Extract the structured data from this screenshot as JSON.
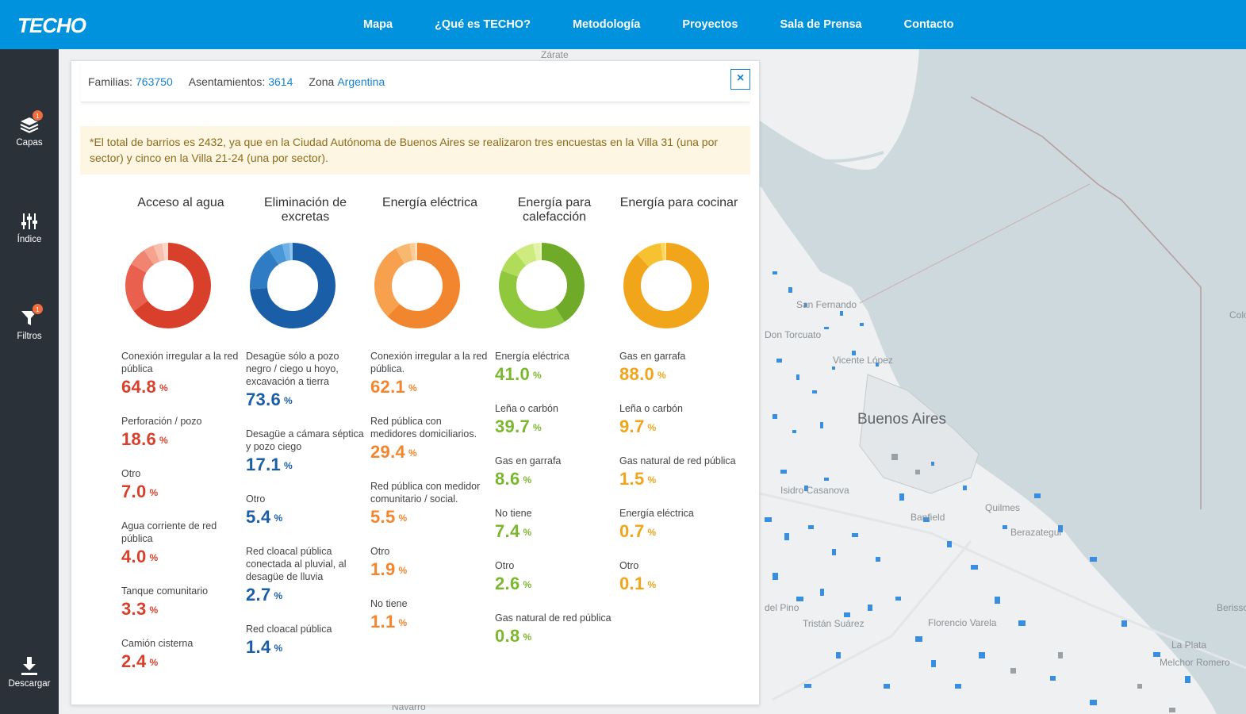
{
  "header": {
    "logo": "TECHO",
    "nav": [
      "Mapa",
      "¿Qué es TECHO?",
      "Metodología",
      "Proyectos",
      "Sala de Prensa",
      "Contacto"
    ]
  },
  "sidebar": {
    "items": [
      {
        "label": "Capas",
        "icon": "layers-icon",
        "badge": "1"
      },
      {
        "label": "Índice",
        "icon": "sliders-icon",
        "badge": ""
      },
      {
        "label": "Filtros",
        "icon": "filter-icon",
        "badge": "1"
      },
      {
        "label": "Descargar",
        "icon": "download-icon",
        "badge": ""
      }
    ]
  },
  "map": {
    "labels": [
      "Zárate",
      "San Fernando",
      "Don Torcuato",
      "Vicente López",
      "Buenos Aires",
      "Isidro Casanova",
      "Banfield",
      "Quilmes",
      "Berazategui",
      "del Pino",
      "Tristán Suárez",
      "Florencio Varela",
      "La Plata",
      "Melchor Romero",
      "Berisso",
      "Colonia del Sacramento",
      "Navarro"
    ]
  },
  "panel": {
    "stats": {
      "familias_label": "Familias:",
      "familias_value": "763750",
      "asentamientos_label": "Asentamientos:",
      "asentamientos_value": "3614",
      "zona_label": "Zona",
      "zona_value": "Argentina"
    },
    "close_label": "×",
    "note": "*El total de barrios es 2432, ya que en la Ciudad Autónoma de Buenos Aires se realizaron tres encuestas en la Villa 31 (una por sector) y cinco en la Villa 21-24 (una por sector).",
    "columns": [
      {
        "title": "Acceso al agua",
        "color": "#d8402c",
        "ring_colors": [
          "#d8402c",
          "#e9604f",
          "#f08470",
          "#f5a38f",
          "#f8bfae",
          "#fbd6cb"
        ],
        "items": [
          {
            "label": "Conexión irregular a la red pública",
            "value": "64.8"
          },
          {
            "label": "Perforación / pozo",
            "value": "18.6"
          },
          {
            "label": "Otro",
            "value": "7.0"
          },
          {
            "label": "Agua corriente de red pública",
            "value": "4.0"
          },
          {
            "label": "Tanque comunitario",
            "value": "3.3"
          },
          {
            "label": "Camión cisterna",
            "value": "2.4"
          }
        ]
      },
      {
        "title": "Eliminación de excretas",
        "color": "#1a5ea8",
        "ring_colors": [
          "#1a5ea8",
          "#2f7cc4",
          "#4a97d8",
          "#6fb1e6",
          "#92c6ef",
          "#b7daf5"
        ],
        "items": [
          {
            "label": "Desagüe sólo a pozo negro / ciego u hoyo, excavación a tierra",
            "value": "73.6"
          },
          {
            "label": "Desagüe a cámara séptica y pozo ciego",
            "value": "17.1"
          },
          {
            "label": "Otro",
            "value": "5.4"
          },
          {
            "label": "Red cloacal pública conectada al pluvial, al desagüe de lluvia",
            "value": "2.7"
          },
          {
            "label": "Red cloacal pública",
            "value": "1.4"
          }
        ]
      },
      {
        "title": "Energía eléctrica",
        "color": "#f2862f",
        "ring_colors": [
          "#f2862f",
          "#f7a14e",
          "#f9b870",
          "#fbcd94",
          "#fddfb8"
        ],
        "items": [
          {
            "label": "Conexión irregular a la red pública.",
            "value": "62.1"
          },
          {
            "label": "Red pública con medidores domiciliarios.",
            "value": "29.4"
          },
          {
            "label": "Red pública con medidor comunitario / social.",
            "value": "5.5"
          },
          {
            "label": "Otro",
            "value": "1.9"
          },
          {
            "label": "No tiene",
            "value": "1.1"
          }
        ]
      },
      {
        "title": "Energía para calefacción",
        "color": "#7cb82f",
        "ring_colors": [
          "#6fab28",
          "#8fc83d",
          "#b1dc59",
          "#cdeb7f",
          "#e2f3a8",
          "#eef8c9"
        ],
        "items": [
          {
            "label": "Energía eléctrica",
            "value": "41.0"
          },
          {
            "label": "Leña o carbón",
            "value": "39.7"
          },
          {
            "label": "Gas en garrafa",
            "value": "8.6"
          },
          {
            "label": "No tiene",
            "value": "7.4"
          },
          {
            "label": "Otro",
            "value": "2.6"
          },
          {
            "label": "Gas natural de red pública",
            "value": "0.8"
          }
        ]
      },
      {
        "title": "Energía para cocinar",
        "color": "#f0a51a",
        "ring_colors": [
          "#f0a51a",
          "#f7c232",
          "#fad65c",
          "#fce488",
          "#fef0b5"
        ],
        "items": [
          {
            "label": "Gas en garrafa",
            "value": "88.0"
          },
          {
            "label": "Leña o carbón",
            "value": "9.7"
          },
          {
            "label": "Gas natural de red pública",
            "value": "1.5"
          },
          {
            "label": "Energía eléctrica",
            "value": "0.7"
          },
          {
            "label": "Otro",
            "value": "0.1"
          }
        ]
      }
    ],
    "percent_symbol": "%"
  }
}
